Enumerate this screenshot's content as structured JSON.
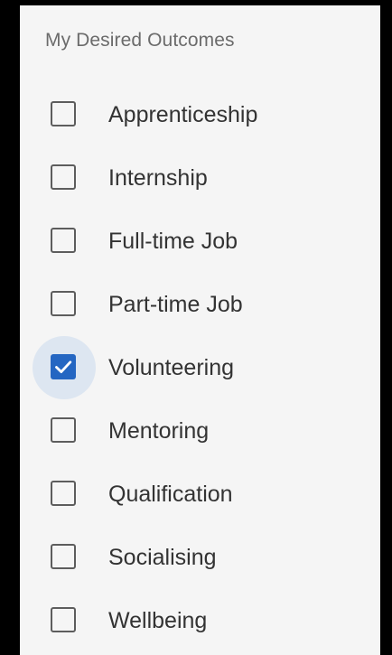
{
  "section": {
    "title": "My Desired Outcomes"
  },
  "options": [
    {
      "label": "Apprenticeship",
      "checked": false
    },
    {
      "label": "Internship",
      "checked": false
    },
    {
      "label": "Full-time Job",
      "checked": false
    },
    {
      "label": "Part-time Job",
      "checked": false
    },
    {
      "label": "Volunteering",
      "checked": true
    },
    {
      "label": "Mentoring",
      "checked": false
    },
    {
      "label": "Qualification",
      "checked": false
    },
    {
      "label": "Socialising",
      "checked": false
    },
    {
      "label": "Wellbeing",
      "checked": false
    }
  ],
  "colors": {
    "accent": "#2466c2",
    "checked_halo": "#dde6f1",
    "panel_background": "#f5f5f5"
  }
}
